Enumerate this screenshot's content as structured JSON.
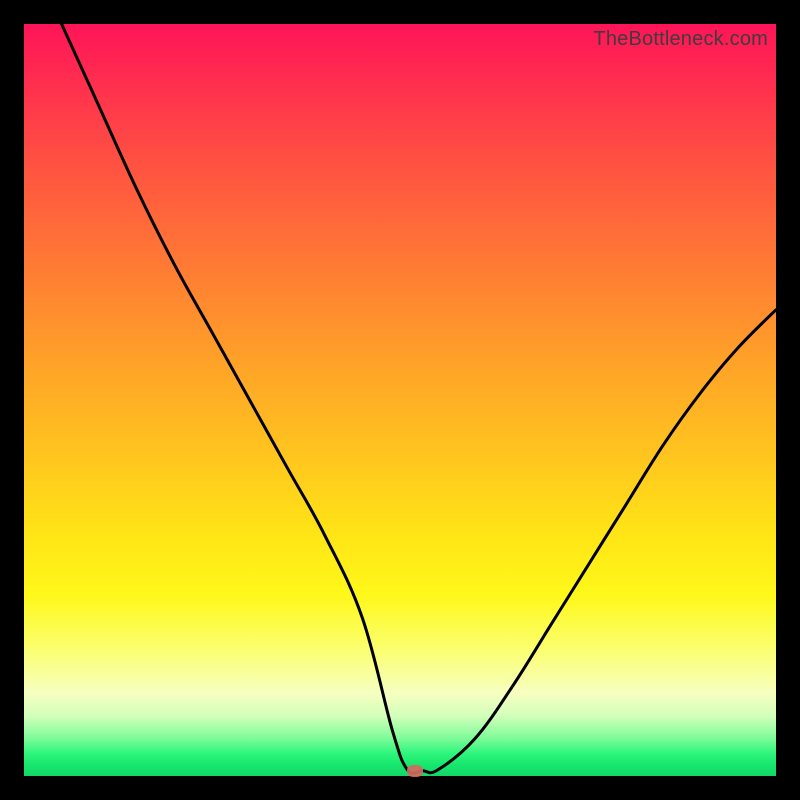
{
  "watermark": "TheBottleneck.com",
  "chart_data": {
    "type": "line",
    "title": "",
    "xlabel": "",
    "ylabel": "",
    "xlim": [
      0,
      100
    ],
    "ylim": [
      0,
      100
    ],
    "grid": false,
    "legend": false,
    "series": [
      {
        "name": "bottleneck-curve",
        "x": [
          5,
          10,
          15,
          20,
          25,
          30,
          35,
          40,
          45,
          49,
          51,
          53,
          55,
          60,
          65,
          70,
          75,
          80,
          85,
          90,
          95,
          100
        ],
        "y": [
          100,
          89,
          78,
          68,
          59,
          50,
          41,
          32,
          21,
          6,
          0.8,
          0.7,
          0.8,
          5,
          12,
          20,
          28,
          36,
          44,
          51,
          57,
          62
        ]
      }
    ],
    "marker": {
      "x": 52,
      "y": 0.6
    },
    "background_gradient": {
      "top": "#ff1458",
      "mid_upper": "#ff9a2c",
      "mid": "#ffe516",
      "mid_lower": "#f6ffc0",
      "bottom": "#12d766"
    }
  }
}
